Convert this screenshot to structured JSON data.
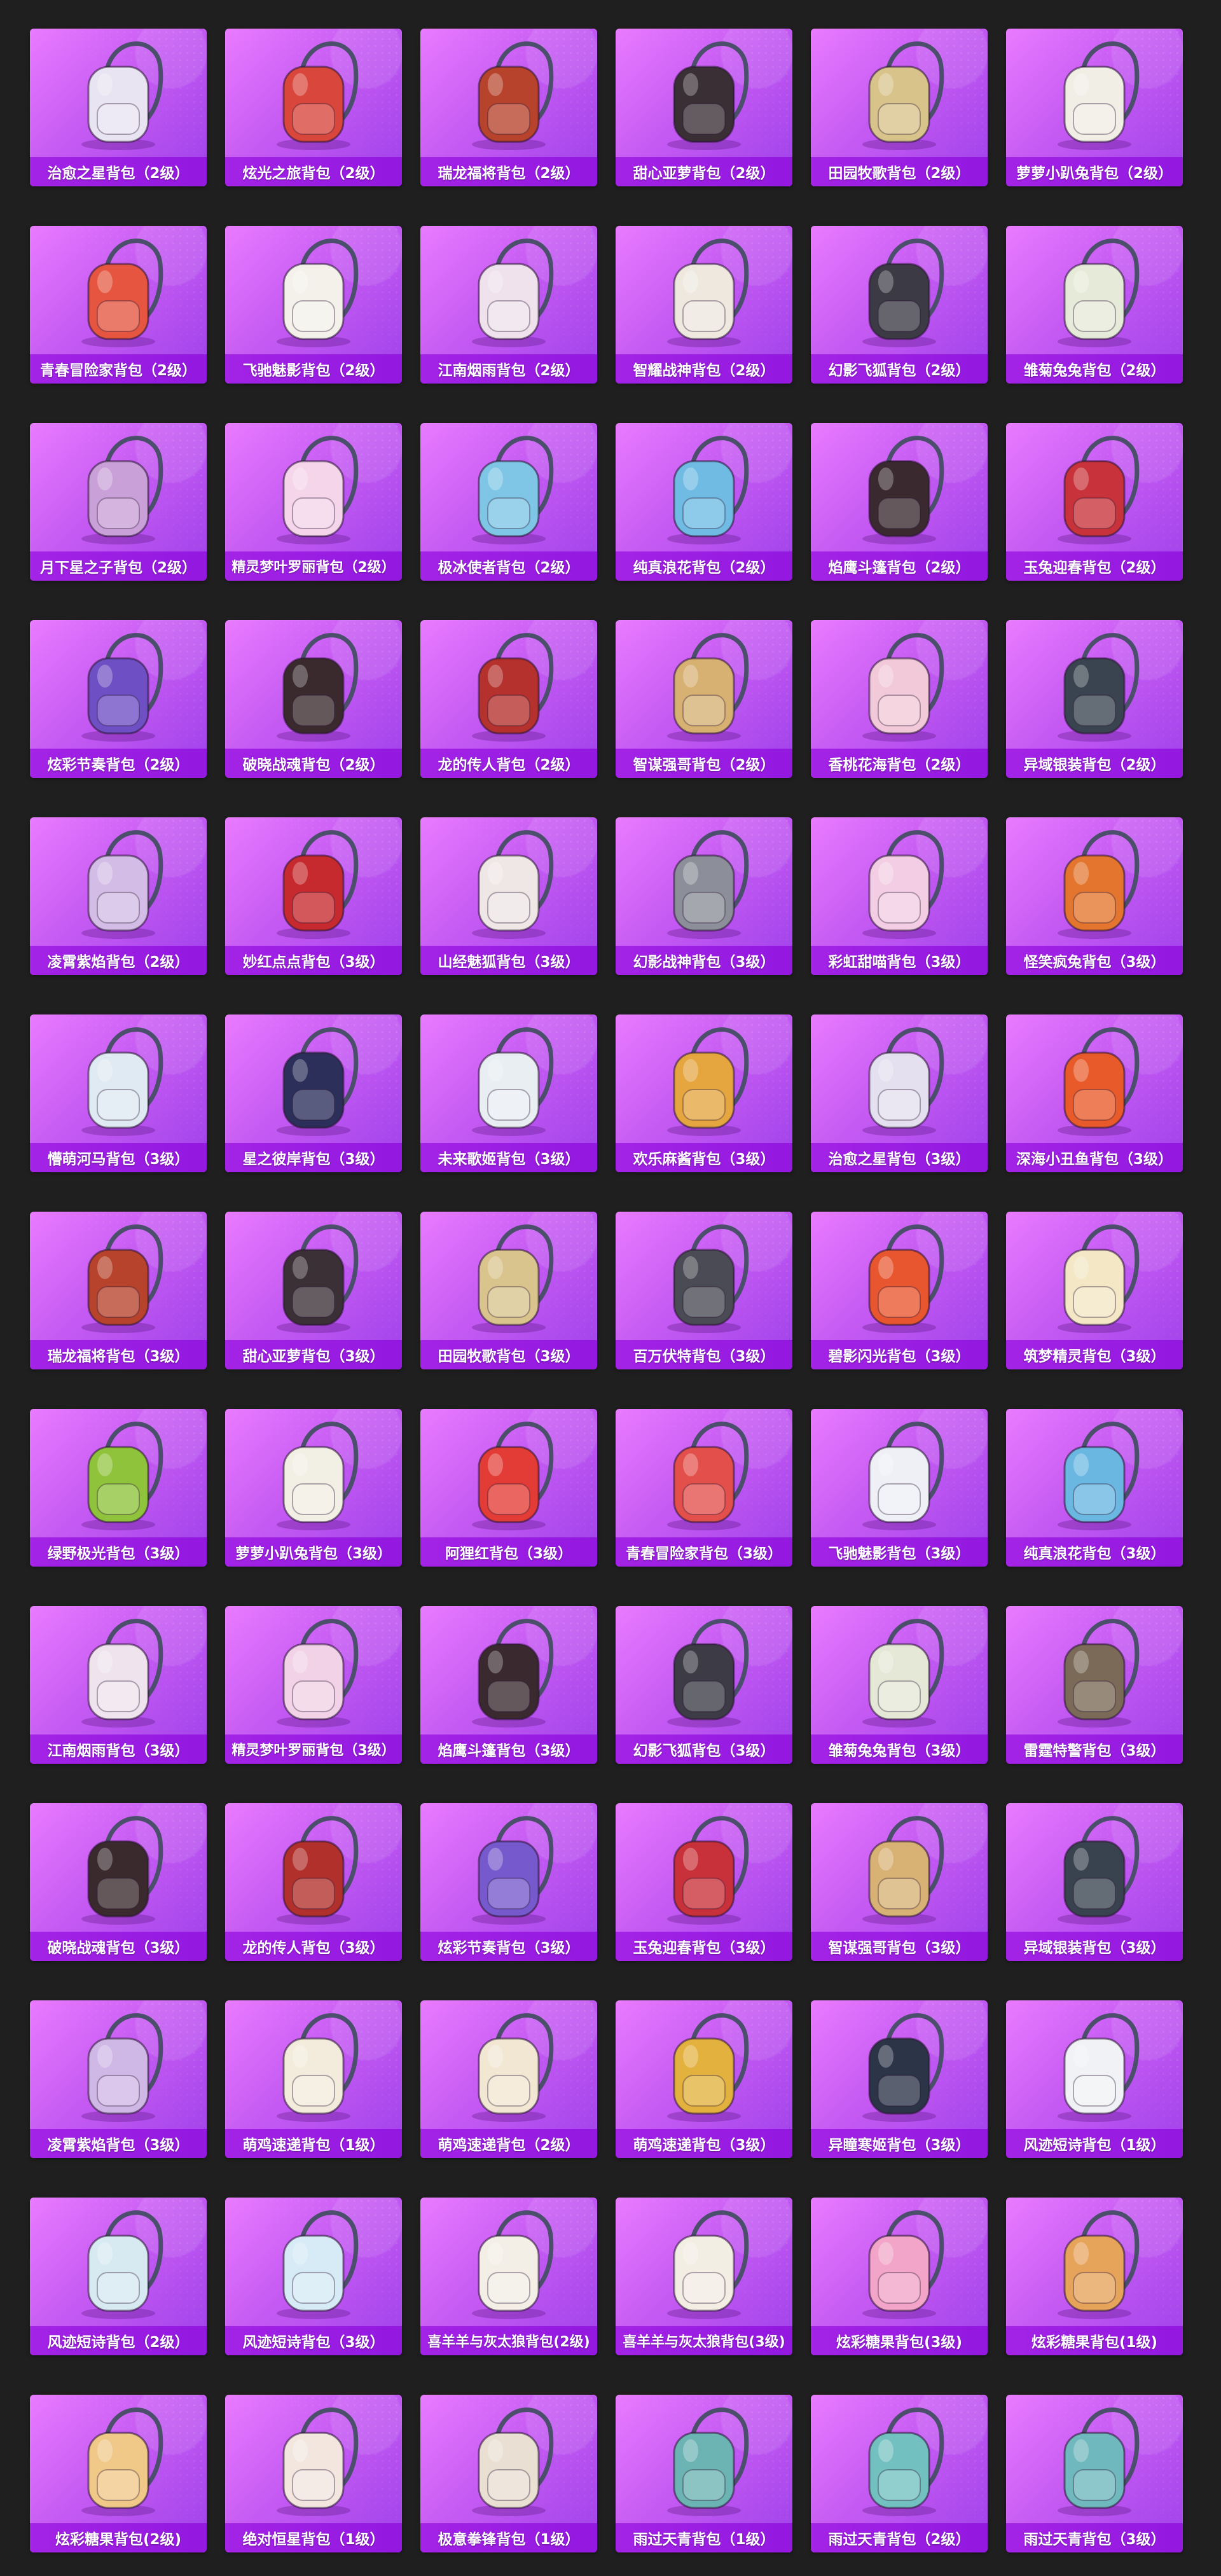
{
  "layout": {
    "columns": 6
  },
  "items": [
    {
      "label": "治愈之星背包（2级）",
      "icon": "backpack-icon",
      "color": "#e9e4f2"
    },
    {
      "label": "炫光之旅背包（2级）",
      "icon": "backpack-icon",
      "color": "#d9463b"
    },
    {
      "label": "瑞龙福将背包（2级）",
      "icon": "backpack-icon",
      "color": "#b8432c"
    },
    {
      "label": "甜心亚萝背包（2级）",
      "icon": "backpack-icon",
      "color": "#3a2f35"
    },
    {
      "label": "田园牧歌背包（2级）",
      "icon": "backpack-icon",
      "color": "#d8c38a"
    },
    {
      "label": "萝萝小趴兔背包（2级）",
      "icon": "backpack-icon",
      "color": "#f1eee6"
    },
    {
      "label": "青春冒险家背包（2级）",
      "icon": "backpack-icon",
      "color": "#e5553f"
    },
    {
      "label": "飞驰魅影背包（2级）",
      "icon": "backpack-icon",
      "color": "#f4f1ea"
    },
    {
      "label": "江南烟雨背包（2级）",
      "icon": "backpack-icon",
      "color": "#efe2ec"
    },
    {
      "label": "智耀战神背包（2级）",
      "icon": "backpack-icon",
      "color": "#eee8df"
    },
    {
      "label": "幻影飞狐背包（2级）",
      "icon": "backpack-icon",
      "color": "#3b3a45"
    },
    {
      "label": "雏菊兔兔背包（2级）",
      "icon": "backpack-icon",
      "color": "#e6ead9"
    },
    {
      "label": "月下星之子背包（2级）",
      "icon": "backpack-icon",
      "color": "#c9a1d8"
    },
    {
      "label": "精灵梦叶罗丽背包（2级）",
      "icon": "backpack-icon",
      "color": "#f4d5ea"
    },
    {
      "label": "极冰使者背包（2级）",
      "icon": "backpack-icon",
      "color": "#7fc6e6"
    },
    {
      "label": "纯真浪花背包（2级）",
      "icon": "backpack-icon",
      "color": "#6fbbe3"
    },
    {
      "label": "焰鹰斗篷背包（2级）",
      "icon": "backpack-icon",
      "color": "#3a2a30"
    },
    {
      "label": "玉兔迎春背包（2级）",
      "icon": "backpack-icon",
      "color": "#c8323a"
    },
    {
      "label": "炫彩节奏背包（2级）",
      "icon": "backpack-icon",
      "color": "#6f4fc4"
    },
    {
      "label": "破晓战魂背包（2级）",
      "icon": "backpack-icon",
      "color": "#3a2a2e"
    },
    {
      "label": "龙的传人背包（2级）",
      "icon": "backpack-icon",
      "color": "#b5312d"
    },
    {
      "label": "智谋强哥背包（2级）",
      "icon": "backpack-icon",
      "color": "#d7b172"
    },
    {
      "label": "香桃花海背包（2级）",
      "icon": "backpack-icon",
      "color": "#f1c9d8"
    },
    {
      "label": "异域银装背包（2级）",
      "icon": "backpack-icon",
      "color": "#3a4450"
    },
    {
      "label": "凌霄紫焰背包（2级）",
      "icon": "backpack-icon",
      "color": "#d3bde6"
    },
    {
      "label": "妙红点点背包（3级）",
      "icon": "backpack-icon",
      "color": "#c62a2f"
    },
    {
      "label": "山经魅狐背包（3级）",
      "icon": "backpack-icon",
      "color": "#efe6e6"
    },
    {
      "label": "幻影战神背包（3级）",
      "icon": "backpack-icon",
      "color": "#8c8f99"
    },
    {
      "label": "彩虹甜喵背包（3级）",
      "icon": "backpack-icon",
      "color": "#f3cde3"
    },
    {
      "label": "怪笑疯兔背包（3级）",
      "icon": "backpack-icon",
      "color": "#e4752e"
    },
    {
      "label": "懵萌河马背包（3级）",
      "icon": "backpack-icon",
      "color": "#dfeaf2"
    },
    {
      "label": "星之彼岸背包（3级）",
      "icon": "backpack-icon",
      "color": "#2b2f5a"
    },
    {
      "label": "未来歌姬背包（3级）",
      "icon": "backpack-icon",
      "color": "#e9eef2"
    },
    {
      "label": "欢乐麻酱背包（3级）",
      "icon": "backpack-icon",
      "color": "#e5a640"
    },
    {
      "label": "治愈之星背包（3级）",
      "icon": "backpack-icon",
      "color": "#e4e0ef"
    },
    {
      "label": "深海小丑鱼背包（3级）",
      "icon": "backpack-icon",
      "color": "#e85a2a"
    },
    {
      "label": "瑞龙福将背包（3级）",
      "icon": "backpack-icon",
      "color": "#b8432c"
    },
    {
      "label": "甜心亚萝背包（3级）",
      "icon": "backpack-icon",
      "color": "#3b3036"
    },
    {
      "label": "田园牧歌背包（3级）",
      "icon": "backpack-icon",
      "color": "#d9c48d"
    },
    {
      "label": "百万伏特背包（3级）",
      "icon": "backpack-icon",
      "color": "#4a4b54"
    },
    {
      "label": "碧影闪光背包（3级）",
      "icon": "backpack-icon",
      "color": "#e8562f"
    },
    {
      "label": "筑梦精灵背包（3级）",
      "icon": "backpack-icon",
      "color": "#f3e7c5"
    },
    {
      "label": "绿野极光背包（3级）",
      "icon": "backpack-icon",
      "color": "#8fc33b"
    },
    {
      "label": "萝萝小趴兔背包（3级）",
      "icon": "backpack-icon",
      "color": "#f2efe5"
    },
    {
      "label": "阿狸红背包（3级）",
      "icon": "backpack-icon",
      "color": "#e33b35"
    },
    {
      "label": "青春冒险家背包（3级）",
      "icon": "backpack-icon",
      "color": "#e3504b"
    },
    {
      "label": "飞驰魅影背包（3级）",
      "icon": "backpack-icon",
      "color": "#eef0f6"
    },
    {
      "label": "纯真浪花背包（3级）",
      "icon": "backpack-icon",
      "color": "#6ab7e2"
    },
    {
      "label": "江南烟雨背包（3级）",
      "icon": "backpack-icon",
      "color": "#efe3ee"
    },
    {
      "label": "精灵梦叶罗丽背包（3级）",
      "icon": "backpack-icon",
      "color": "#f2d2e6"
    },
    {
      "label": "焰鹰斗篷背包（3级）",
      "icon": "backpack-icon",
      "color": "#3a2a30"
    },
    {
      "label": "幻影飞狐背包（3级）",
      "icon": "backpack-icon",
      "color": "#3c3b46"
    },
    {
      "label": "雏菊兔兔背包（3级）",
      "icon": "backpack-icon",
      "color": "#e5e8d6"
    },
    {
      "label": "雷霆特警背包（3级）",
      "icon": "backpack-icon",
      "color": "#7a6a57"
    },
    {
      "label": "破晓战魂背包（3级）",
      "icon": "backpack-icon",
      "color": "#3a2a2e"
    },
    {
      "label": "龙的传人背包（3级）",
      "icon": "backpack-icon",
      "color": "#b2302c"
    },
    {
      "label": "炫彩节奏背包（3级）",
      "icon": "backpack-icon",
      "color": "#7659cc"
    },
    {
      "label": "玉兔迎春背包（3级）",
      "icon": "backpack-icon",
      "color": "#c9313a"
    },
    {
      "label": "智谋强哥背包（3级）",
      "icon": "backpack-icon",
      "color": "#d8b274"
    },
    {
      "label": "异域银装背包（3级）",
      "icon": "backpack-icon",
      "color": "#394350"
    },
    {
      "label": "凌霄紫焰背包（3级）",
      "icon": "backpack-icon",
      "color": "#d0b8e6"
    },
    {
      "label": "萌鸡速递背包（1级）",
      "icon": "backpack-icon",
      "color": "#f3ecdc"
    },
    {
      "label": "萌鸡速递背包（2级）",
      "icon": "backpack-icon",
      "color": "#f2e7d3"
    },
    {
      "label": "萌鸡速递背包（3级）",
      "icon": "backpack-icon",
      "color": "#e3b23e"
    },
    {
      "label": "异瞳寒姬背包（3级）",
      "icon": "backpack-icon",
      "color": "#2c3447"
    },
    {
      "label": "风迹短诗背包（1级）",
      "icon": "backpack-icon",
      "color": "#f0f2f5"
    },
    {
      "label": "风迹短诗背包（2级）",
      "icon": "backpack-icon",
      "color": "#d7eaf2"
    },
    {
      "label": "风迹短诗背包（3级）",
      "icon": "backpack-icon",
      "color": "#d6ebf5"
    },
    {
      "label": "喜羊羊与灰太狼背包(2级)",
      "icon": "backpack-icon",
      "color": "#f3efe7"
    },
    {
      "label": "喜羊羊与灰太狼背包(3级)",
      "icon": "backpack-icon",
      "color": "#f3eee4"
    },
    {
      "label": "炫彩糖果背包(3级)",
      "icon": "backpack-icon",
      "color": "#f2a5c8"
    },
    {
      "label": "炫彩糖果背包(1级)",
      "icon": "backpack-icon",
      "color": "#e6a35a"
    },
    {
      "label": "炫彩糖果背包(2级)",
      "icon": "backpack-icon",
      "color": "#f0c888"
    },
    {
      "label": "绝对恒星背包（1级）",
      "icon": "backpack-icon",
      "color": "#f2e6df"
    },
    {
      "label": "极意拳锋背包（1级）",
      "icon": "backpack-icon",
      "color": "#e9dfd2"
    },
    {
      "label": "雨过天青背包（1级）",
      "icon": "backpack-icon",
      "color": "#6cb3b3"
    },
    {
      "label": "雨过天青背包（2级）",
      "icon": "backpack-icon",
      "color": "#72c1c0"
    },
    {
      "label": "雨过天青背包（3级）",
      "icon": "backpack-icon",
      "color": "#6fb8bd"
    }
  ]
}
